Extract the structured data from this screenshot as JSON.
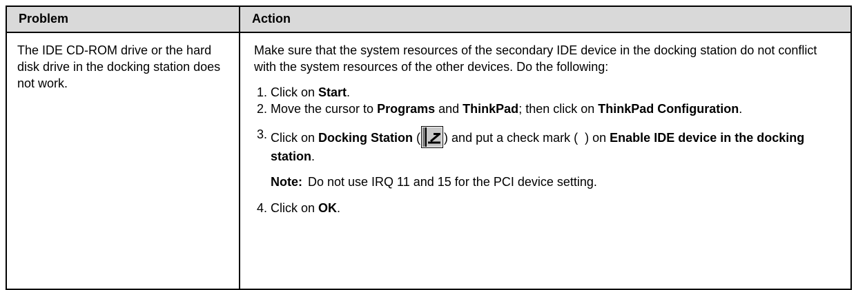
{
  "table": {
    "headers": {
      "problem": "Problem",
      "action": "Action"
    },
    "problem_text": "The IDE CD-ROM drive or the hard disk drive in the docking station does not work.",
    "action": {
      "intro": "Make sure that the system resources of the secondary IDE device in the docking station do not conflict with the system resources of the other devices. Do the following:",
      "steps": [
        {
          "number": "1.",
          "pre": "Click on ",
          "bold": "Start",
          "post": "."
        },
        {
          "number": "2.",
          "pre": "Move the cursor to ",
          "bold1": "Programs",
          "mid1": " and ",
          "bold2": "ThinkPad",
          "mid2": "; then click on ",
          "bold3": "ThinkPad Configuration",
          "post": "."
        },
        {
          "number": "3.",
          "pre": "Click on ",
          "bold1": "Docking Station",
          "paren_open": " (",
          "paren_close": ") and put a check mark (",
          "paren_close2": ") on ",
          "bold2": "Enable IDE device in the docking station",
          "post": "."
        },
        {
          "number": "4.",
          "pre": "Click on ",
          "bold": "OK",
          "post": "."
        }
      ],
      "note": {
        "label": "Note:",
        "text": "Do not use IRQ 11 and 15 for the PCI device setting."
      }
    }
  },
  "icons": {
    "docking_station": "docking-station-icon"
  },
  "colors": {
    "header_bg": "#d9d9d9",
    "border": "#000000",
    "text": "#000000"
  }
}
